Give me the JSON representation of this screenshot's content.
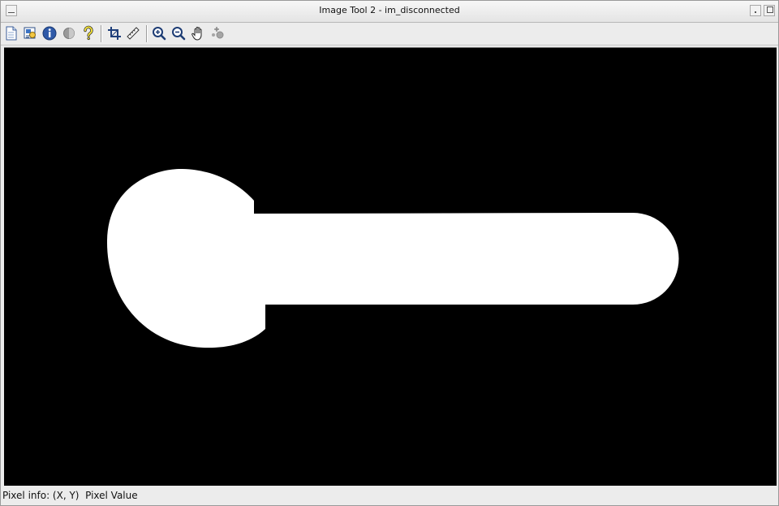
{
  "window": {
    "title": "Image Tool 2 - im_disconnected"
  },
  "toolbar": {
    "tools": [
      {
        "name": "new-document-icon"
      },
      {
        "name": "image-properties-icon"
      },
      {
        "name": "info-icon"
      },
      {
        "name": "contrast-icon"
      },
      {
        "name": "help-icon"
      },
      {
        "name": "crop-icon"
      },
      {
        "name": "ruler-icon"
      },
      {
        "name": "zoom-in-icon"
      },
      {
        "name": "zoom-out-icon"
      },
      {
        "name": "pan-hand-icon"
      },
      {
        "name": "overview-icon"
      }
    ]
  },
  "canvas": {
    "background": "#000000",
    "foreground": "#ffffff"
  },
  "status": {
    "text": "Pixel info: (X, Y)  Pixel Value"
  }
}
